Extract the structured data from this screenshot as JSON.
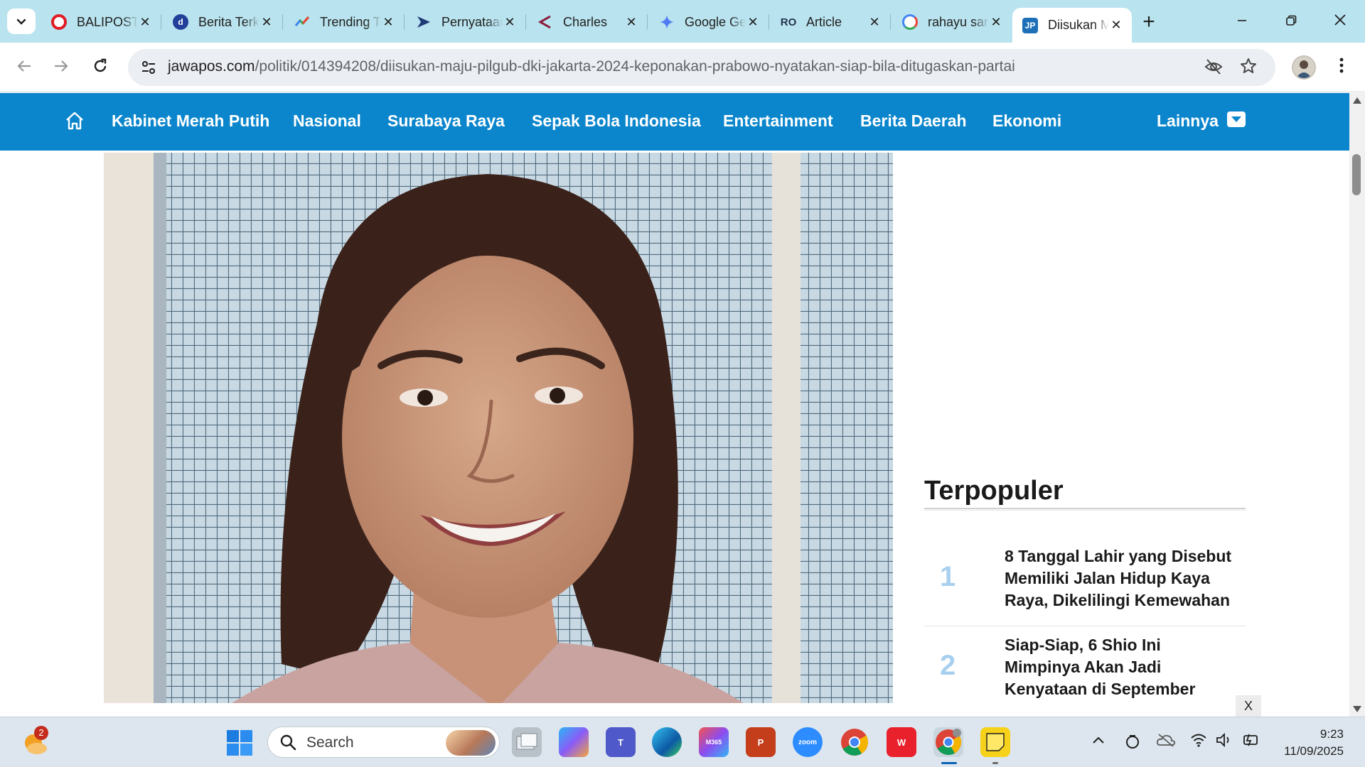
{
  "browser": {
    "tabs": [
      {
        "title": "BALIPOST.com",
        "favicon": "opera-icon",
        "color": "#e21b23",
        "active": false
      },
      {
        "title": "Berita Terkini",
        "favicon": "detik-icon",
        "color": "#22409a",
        "active": false
      },
      {
        "title": "Trending Topics",
        "favicon": "trending-icon",
        "color": "#36a852",
        "active": false
      },
      {
        "title": "Pernyataan",
        "favicon": "bookmark-arrow-icon",
        "color": "#1f3b78",
        "active": false
      },
      {
        "title": "Charles",
        "favicon": "bracket-icon",
        "color": "#8b1d3c",
        "active": false
      },
      {
        "title": "Google Gemini",
        "favicon": "gemini-icon",
        "color": "#4f7cf3",
        "active": false
      },
      {
        "title": "Article",
        "favicon": "ro-icon",
        "color": "#23344f",
        "active": false
      },
      {
        "title": "rahayu saraswati",
        "favicon": "google-icon",
        "color": "#4285f4",
        "active": false
      },
      {
        "title": "Diisukan Maju Pilgub",
        "favicon": "jp-icon",
        "color": "#1d70b8",
        "active": true
      }
    ],
    "url_host": "jawapos.com",
    "url_path": "/politik/014394208/diisukan-maju-pilgub-dki-jakarta-2024-keponakan-prabowo-nyatakan-siap-bila-ditugaskan-partai"
  },
  "site_nav": {
    "items": [
      "Kabinet Merah Putih",
      "Nasional",
      "Surabaya Raya",
      "Sepak Bola Indonesia",
      "Entertainment",
      "Berita Daerah",
      "Ekonomi"
    ],
    "more_label": "Lainnya"
  },
  "sidebar": {
    "popular_title": "Terpopuler",
    "popular": [
      {
        "rank": "1",
        "title": "8 Tanggal Lahir yang Disebut Memiliki Jalan Hidup Kaya Raya, Dikelilingi Kemewahan"
      },
      {
        "rank": "2",
        "title": "Siap-Siap, 6 Shio Ini Mimpinya Akan Jadi Kenyataan di September"
      }
    ],
    "ad_close_label": "X"
  },
  "taskbar": {
    "search_label": "Search",
    "weather_badge": "2",
    "time": "9:23",
    "date": "11/09/2025",
    "apps": [
      "file-explorer-icon",
      "copilot-icon",
      "teams-icon",
      "edge-icon",
      "m365-icon",
      "powerpoint-icon",
      "zoom-icon",
      "chrome-icon",
      "wps-icon",
      "chrome-profile-icon",
      "sticky-notes-icon"
    ]
  },
  "colors": {
    "tabstrip": "#b9e3ee",
    "site_nav": "#0b86cc",
    "rank": "#a8d0ee"
  }
}
